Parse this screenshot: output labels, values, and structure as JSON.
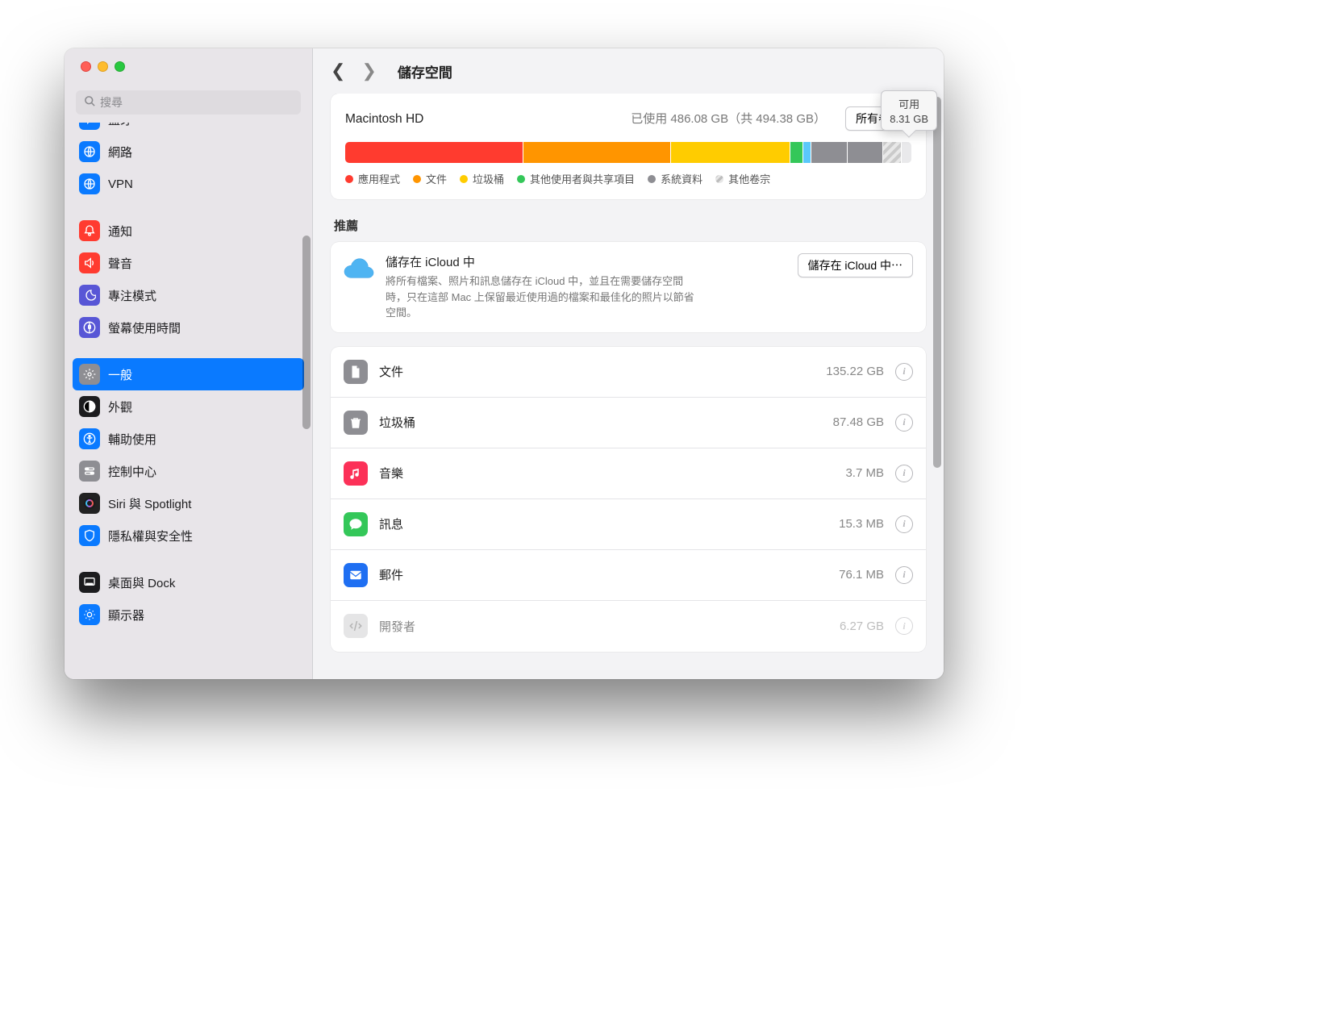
{
  "header": {
    "title": "儲存空間"
  },
  "search": {
    "placeholder": "搜尋"
  },
  "sidebar": [
    {
      "label": "藍牙",
      "icon_bg": "#0a7aff",
      "partial": true
    },
    {
      "label": "網路",
      "icon_bg": "#0a7aff"
    },
    {
      "label": "VPN",
      "icon_bg": "#0a7aff"
    },
    {
      "sep": true
    },
    {
      "label": "通知",
      "icon_bg": "#ff3b30"
    },
    {
      "label": "聲音",
      "icon_bg": "#ff3b30"
    },
    {
      "label": "專注模式",
      "icon_bg": "#5856d6"
    },
    {
      "label": "螢幕使用時間",
      "icon_bg": "#5856d6"
    },
    {
      "sep": true
    },
    {
      "label": "一般",
      "icon_bg": "#8e8e93",
      "selected": true
    },
    {
      "label": "外觀",
      "icon_bg": "#1c1c1e"
    },
    {
      "label": "輔助使用",
      "icon_bg": "#0a7aff"
    },
    {
      "label": "控制中心",
      "icon_bg": "#8e8e93"
    },
    {
      "label": "Siri 與 Spotlight",
      "icon_bg": "#222"
    },
    {
      "label": "隱私權與安全性",
      "icon_bg": "#0a7aff"
    },
    {
      "sep": true
    },
    {
      "label": "桌面與 Dock",
      "icon_bg": "#1c1c1e"
    },
    {
      "label": "顯示器",
      "icon_bg": "#0a7aff"
    }
  ],
  "storage": {
    "disk_name": "Macintosh HD",
    "usage_text": "已使用 486.08 GB（共 494.38 GB）",
    "all_volumes_btn": "所有卷宗",
    "tooltip_label": "可用",
    "tooltip_value": "8.31 GB",
    "segments": [
      {
        "color": "#ff3b2f",
        "pct": 31.5
      },
      {
        "color": "#ff9500",
        "pct": 26
      },
      {
        "color": "#ffcc00",
        "pct": 21.2
      },
      {
        "color": "#34c759",
        "pct": 2.2
      },
      {
        "color": "#5ac8fa",
        "pct": 1.5
      },
      {
        "color": "#8e8e93",
        "pct": 6.3
      },
      {
        "color": "#8e8e93",
        "pct": 6.3
      },
      {
        "hatch": true,
        "pct": 3.3
      },
      {
        "color": "#e9e9eb",
        "pct": 1.7
      }
    ],
    "legend": [
      {
        "color": "#ff3b2f",
        "label": "應用程式"
      },
      {
        "color": "#ff9500",
        "label": "文件"
      },
      {
        "color": "#ffcc00",
        "label": "垃圾桶"
      },
      {
        "color": "#34c759",
        "label": "其他使用者與共享項目"
      },
      {
        "color": "#8e8e93",
        "label": "系統資料"
      },
      {
        "hatch": true,
        "label": "其他卷宗"
      }
    ]
  },
  "recommend": {
    "section_title": "推薦",
    "title": "儲存在 iCloud 中",
    "desc": "將所有檔案、照片和訊息儲存在 iCloud 中，並且在需要儲存空間時，只在這部 Mac 上保留最近使用過的檔案和最佳化的照片以節省空間。",
    "button": "儲存在 iCloud 中⋯"
  },
  "categories": [
    {
      "label": "文件",
      "size": "135.22 GB",
      "icon_bg": "#8e8e93",
      "icon": "doc"
    },
    {
      "label": "垃圾桶",
      "size": "87.48 GB",
      "icon_bg": "#8e8e93",
      "icon": "trash"
    },
    {
      "label": "音樂",
      "size": "3.7 MB",
      "icon_bg": "#fc3158",
      "icon": "music"
    },
    {
      "label": "訊息",
      "size": "15.3 MB",
      "icon_bg": "#34c759",
      "icon": "message"
    },
    {
      "label": "郵件",
      "size": "76.1 MB",
      "icon_bg": "#1f6ff2",
      "icon": "mail"
    },
    {
      "label": "開發者",
      "size": "6.27 GB",
      "icon_bg": "#d0d0d3",
      "icon": "dev",
      "partial": true
    }
  ]
}
